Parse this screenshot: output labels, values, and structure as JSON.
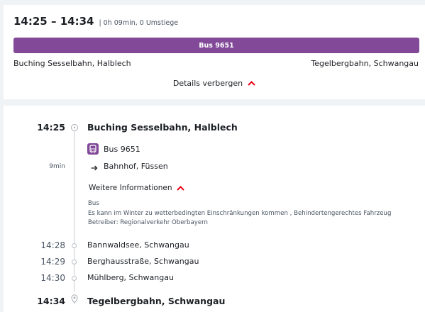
{
  "summary": {
    "times": "14:25 – 14:34",
    "meta": "| 0h 09min, 0 Umstiege",
    "bus_label": "Bus 9651",
    "from": "Buching Sesselbahn, Halblech",
    "to": "Tegelbergbahn, Schwangau",
    "details_toggle": "Details verbergen"
  },
  "detail": {
    "departure": {
      "time": "14:25",
      "stop": "Buching Sesselbahn, Halblech"
    },
    "product": "Bus 9651",
    "duration": "9min",
    "direction": "Bahnhof, Füssen",
    "more_info_label": "Weitere Informationen",
    "info_lines": [
      "Bus",
      "Es kann im Winter zu wetterbedingten Einschränkungen kommen , Behindertengerechtes Fahrzeug",
      "Betreiber: Regionalverkehr Oberbayern"
    ],
    "intermediate_stops": [
      {
        "time": "14:28",
        "stop": "Bannwaldsee, Schwangau"
      },
      {
        "time": "14:29",
        "stop": "Berghausstraße, Schwangau"
      },
      {
        "time": "14:30",
        "stop": "Mühlberg, Schwangau"
      }
    ],
    "arrival": {
      "time": "14:34",
      "stop": "Tegelbergbahn, Schwangau"
    }
  },
  "colors": {
    "bus_purple": "#814997",
    "accent_red": "#ec0016",
    "background": "#f0f3f5"
  },
  "icons": [
    "bus-icon",
    "arrow-right-icon",
    "chevron-up-icon",
    "location-pin-icon"
  ]
}
